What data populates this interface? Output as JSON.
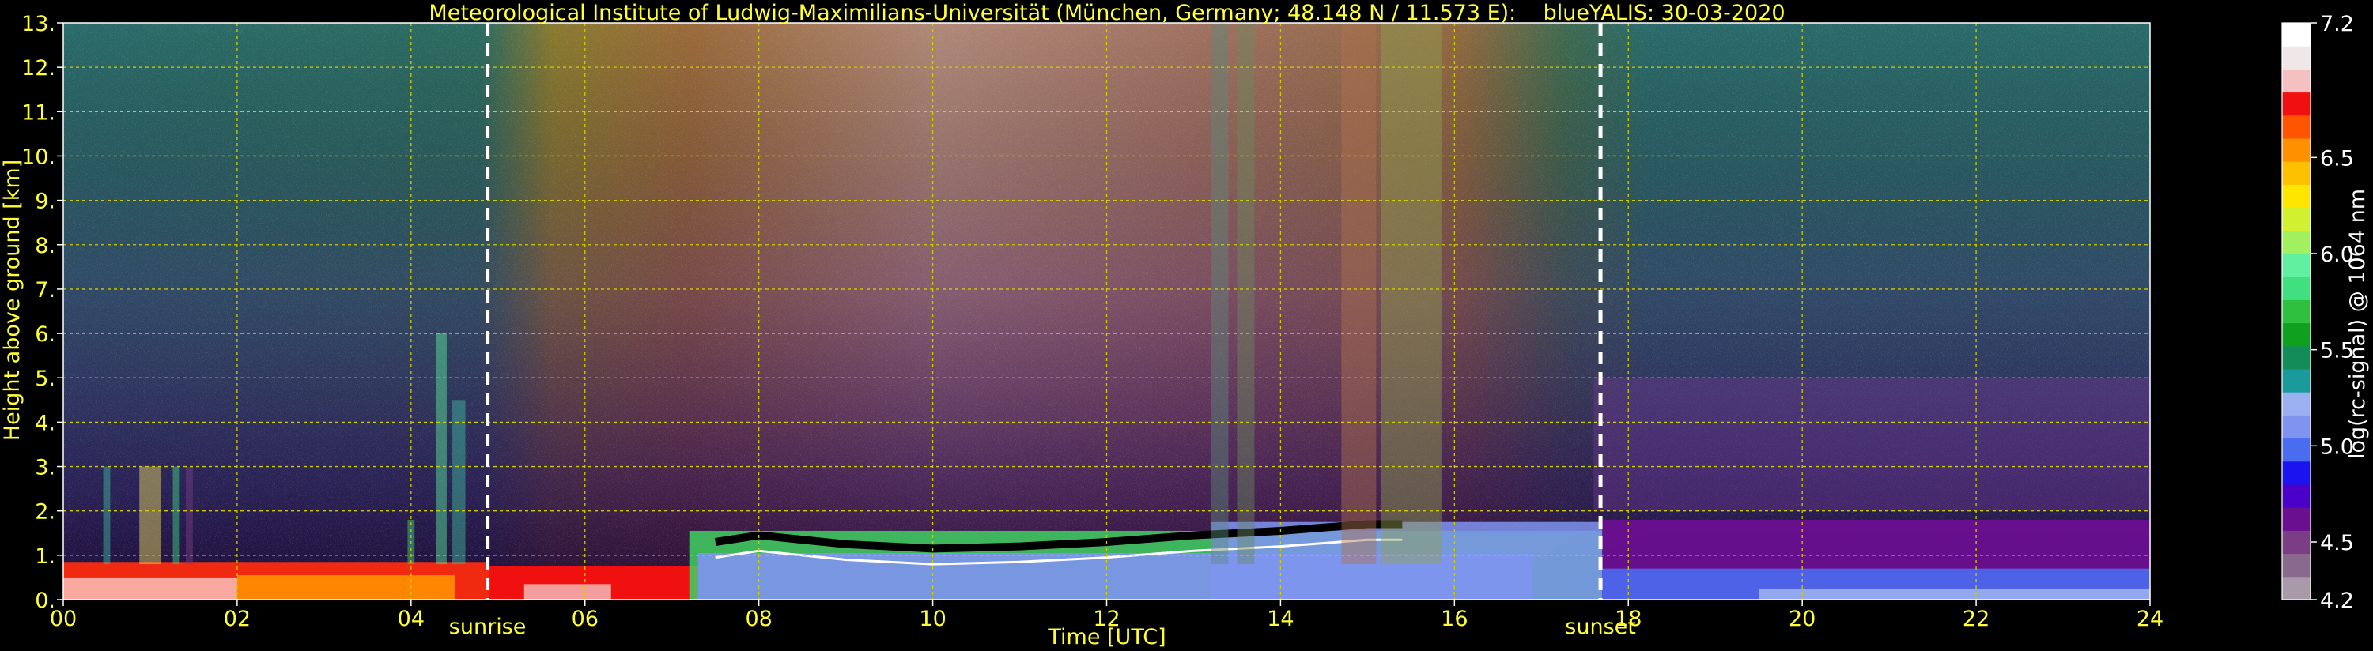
{
  "chart_data": {
    "type": "heatmap",
    "title": "Meteorological Institute of Ludwig-Maximilians-Universität (München, Germany; 48.148 N / 11.573 E):    blueYALIS: 30-03-2020",
    "xlabel": "Time [UTC]",
    "ylabel": "Height above ground [km]",
    "colorbar_label": "log(rc-signal) @ 1064 nm",
    "xlim": [
      0,
      24
    ],
    "ylim": [
      0,
      13
    ],
    "x_ticks": [
      "00",
      "02",
      "04",
      "06",
      "08",
      "10",
      "12",
      "14",
      "16",
      "18",
      "20",
      "22",
      "24"
    ],
    "y_ticks": [
      "0.",
      "1.",
      "2.",
      "3.",
      "4.",
      "5.",
      "6.",
      "7.",
      "8.",
      "9.",
      "10.",
      "11.",
      "12.",
      "13."
    ],
    "colorbar_range": [
      4.2,
      7.2
    ],
    "colorbar_ticks": [
      "4.2",
      "4.5",
      "5.0",
      "5.5",
      "6.0",
      "6.5",
      "7.2"
    ],
    "grid": true,
    "grid_color": "#cccc00",
    "annotations": [
      {
        "label": "sunrise",
        "x": 4.88
      },
      {
        "label": "sunset",
        "x": 17.68
      }
    ],
    "colormap": [
      "#a89aa8",
      "#8a6a8c",
      "#7a3d86",
      "#6a0f90",
      "#4a00c8",
      "#1b14f0",
      "#4a6cf0",
      "#7f94f0",
      "#9ab0f0",
      "#1a9a9a",
      "#148c5a",
      "#10a020",
      "#30c040",
      "#40e080",
      "#60f0a0",
      "#a0f060",
      "#d0f030",
      "#ffe600",
      "#ffc000",
      "#ff9000",
      "#ff5500",
      "#f01010",
      "#f5c0c0",
      "#f0e8e8",
      "#ffffff"
    ]
  }
}
